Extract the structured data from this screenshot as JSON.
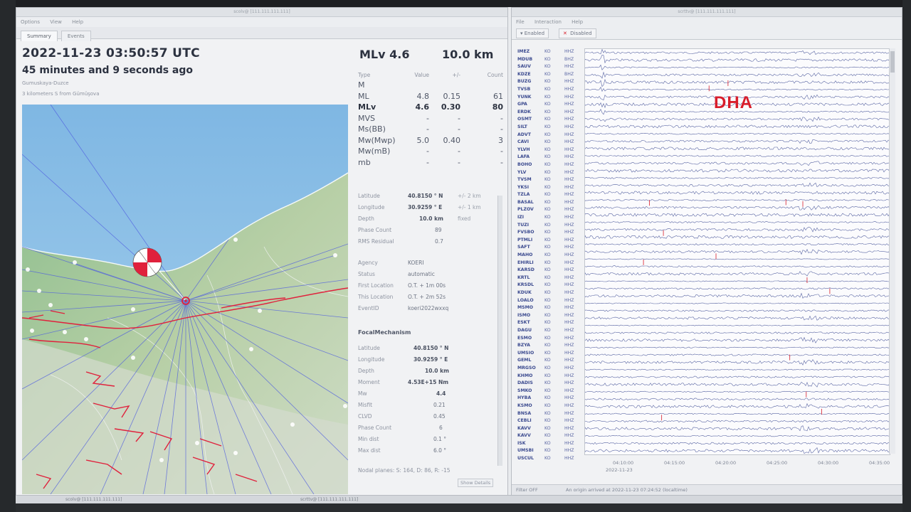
{
  "left_window": {
    "title": "scolv@ [111.111.111.111]",
    "menu": [
      "Options",
      "View",
      "Help"
    ],
    "tabs": [
      "Summary",
      "Events"
    ],
    "event": {
      "time": "2022-11-23 03:50:57 UTC",
      "ago": "45 minutes and 9 seconds ago",
      "region": "Gumuskaya-Duzce",
      "distance": "3 kilometers S from Gümüşova"
    },
    "headline": {
      "magnitude": "MLv 4.6",
      "depth": "10.0 km"
    },
    "magnitudes": {
      "headers": [
        "Type",
        "Value",
        "+/-",
        "Count"
      ],
      "rows": [
        {
          "type": "M",
          "value": "",
          "unc": "",
          "count": ""
        },
        {
          "type": "ML",
          "value": "4.8",
          "unc": "0.15",
          "count": "61"
        },
        {
          "type": "MLv",
          "value": "4.6",
          "unc": "0.30",
          "count": "80"
        },
        {
          "type": "MVS",
          "value": "-",
          "unc": "-",
          "count": "-"
        },
        {
          "type": "Ms(BB)",
          "value": "-",
          "unc": "-",
          "count": "-"
        },
        {
          "type": "Mw(Mwp)",
          "value": "5.0",
          "unc": "0.40",
          "count": "3"
        },
        {
          "type": "Mw(mB)",
          "value": "-",
          "unc": "-",
          "count": "-"
        },
        {
          "type": "mb",
          "value": "-",
          "unc": "-",
          "count": "-"
        }
      ]
    },
    "origin": {
      "latitude": {
        "label": "Latitude",
        "value": "40.8150 ° N",
        "extra": "+/-   2 km"
      },
      "longitude": {
        "label": "Longitude",
        "value": "30.9259 ° E",
        "extra": "+/-   1 km"
      },
      "depth": {
        "label": "Depth",
        "value": "10.0 km",
        "extra": "fixed"
      },
      "phase_count": {
        "label": "Phase Count",
        "value": "89"
      },
      "rms": {
        "label": "RMS Residual",
        "value": "0.7"
      },
      "agency": {
        "label": "Agency",
        "value": "KOERI"
      },
      "status": {
        "label": "Status",
        "value": "automatic"
      },
      "first_location": {
        "label": "First Location",
        "value": "O.T. + 1m 00s"
      },
      "this_location": {
        "label": "This Location",
        "value": "O.T. + 2m 52s"
      },
      "event_id": {
        "label": "EventID",
        "value": "koeri2022wxxq"
      }
    },
    "focal": {
      "title": "FocalMechanism",
      "rows": [
        {
          "label": "Latitude",
          "value": "40.8150 ° N"
        },
        {
          "label": "Longitude",
          "value": "30.9259 ° E"
        },
        {
          "label": "Depth",
          "value": "10.0 km"
        },
        {
          "label": "Moment",
          "value": "4.53E+15 Nm"
        },
        {
          "label": "Mw",
          "value": "4.4"
        },
        {
          "label": "Misfit",
          "value": "0.21"
        },
        {
          "label": "CLVD",
          "value": "0.45"
        },
        {
          "label": "Phase Count",
          "value": "6"
        },
        {
          "label": "Min dist",
          "value": "0.1 °"
        },
        {
          "label": "Max dist",
          "value": "6.0 °"
        }
      ],
      "nodal": "Nodal planes:  S: 164, D: 86, R: -15"
    },
    "show_details": "Show Details"
  },
  "right_window": {
    "title": "scrttv@ [111.111.111.111]",
    "menu": [
      "File",
      "Interaction",
      "Help"
    ],
    "filter_enabled": "Enabled",
    "filter_disabled": "Disabled",
    "stations": [
      [
        "IMEZ",
        "KO",
        "HHZ"
      ],
      [
        "MDUB",
        "KO",
        "BHZ"
      ],
      [
        "SAUV",
        "KO",
        "HHZ"
      ],
      [
        "KDZE",
        "KO",
        "BHZ"
      ],
      [
        "BUZG",
        "KO",
        "HHZ"
      ],
      [
        "TVSB",
        "KO",
        "HHZ"
      ],
      [
        "YUNK",
        "KO",
        "HHZ"
      ],
      [
        "GPA",
        "KO",
        "HHZ"
      ],
      [
        "ERDK",
        "KO",
        "HHZ"
      ],
      [
        "OSMT",
        "KO",
        "HHZ"
      ],
      [
        "SILT",
        "KO",
        "HHZ"
      ],
      [
        "ADVT",
        "KO",
        "HHZ"
      ],
      [
        "CAVI",
        "KO",
        "HHZ"
      ],
      [
        "YLVH",
        "KO",
        "HHZ"
      ],
      [
        "LAFA",
        "KO",
        "HHZ"
      ],
      [
        "BOHO",
        "KO",
        "HHZ"
      ],
      [
        "YLV",
        "KO",
        "HHZ"
      ],
      [
        "TVSM",
        "KO",
        "HHZ"
      ],
      [
        "YKSI",
        "KO",
        "HHZ"
      ],
      [
        "TZLA",
        "KO",
        "HHZ"
      ],
      [
        "BASAL",
        "KO",
        "HHZ"
      ],
      [
        "PLZOV",
        "KO",
        "HHZ"
      ],
      [
        "IZI",
        "KO",
        "HHZ"
      ],
      [
        "TUZI",
        "KO",
        "HHZ"
      ],
      [
        "FVSBO",
        "KO",
        "HHZ"
      ],
      [
        "PTMLI",
        "KO",
        "HHZ"
      ],
      [
        "SAFT",
        "KO",
        "HHZ"
      ],
      [
        "MAHO",
        "KO",
        "HHZ"
      ],
      [
        "EHIRLI",
        "KO",
        "HHZ"
      ],
      [
        "KARSD",
        "KO",
        "HHZ"
      ],
      [
        "KRTL",
        "KO",
        "HHZ"
      ],
      [
        "KRSDL",
        "KO",
        "HHZ"
      ],
      [
        "KDUK",
        "KO",
        "HHZ"
      ],
      [
        "LOALO",
        "KO",
        "HHZ"
      ],
      [
        "MSMO",
        "KO",
        "HHZ"
      ],
      [
        "ISMO",
        "KO",
        "HHZ"
      ],
      [
        "ESKT",
        "KO",
        "HHZ"
      ],
      [
        "DAGU",
        "KO",
        "HHZ"
      ],
      [
        "ESMO",
        "KO",
        "HHZ"
      ],
      [
        "BZYA",
        "KO",
        "HHZ"
      ],
      [
        "UMSIO",
        "KO",
        "HHZ"
      ],
      [
        "GEML",
        "KO",
        "HHZ"
      ],
      [
        "MRGSO",
        "KO",
        "HHZ"
      ],
      [
        "KHMO",
        "KO",
        "HHZ"
      ],
      [
        "DADIS",
        "KO",
        "HHZ"
      ],
      [
        "SMKO",
        "KO",
        "HHZ"
      ],
      [
        "HYBA",
        "KO",
        "HHZ"
      ],
      [
        "KSMO",
        "KO",
        "HHZ"
      ],
      [
        "BNSA",
        "KO",
        "HHZ"
      ],
      [
        "CEBLI",
        "KO",
        "HHZ"
      ],
      [
        "KAVV",
        "KO",
        "HHZ"
      ],
      [
        "KAVV",
        "KO",
        "HHZ"
      ],
      [
        "ISK",
        "KO",
        "HHZ"
      ],
      [
        "UMSBI",
        "KO",
        "HHZ"
      ],
      [
        "USCUL",
        "KO",
        "HHZ"
      ]
    ],
    "time_ticks": [
      "04:10:00",
      "04:15:00",
      "04:20:00",
      "04:25:00",
      "04:30:00",
      "04:35:00"
    ],
    "time_date": "2022-11-23",
    "status_left": "Filter OFF",
    "status_msg": "An origin arrived at 2022-11-23 07:24:52 (localtime)",
    "logo": "DHA"
  },
  "taskbar": {
    "items": [
      "scolv@ [111.111.111.111]",
      "scrttv@ [111.111.111.111]"
    ]
  },
  "colors": {
    "accent": "#d81d2b",
    "trace": "#5b67a4",
    "ray": "#4e5ce0",
    "fault": "#e0213c"
  },
  "icons": [
    "beachball-icon",
    "epicenter-icon",
    "close-icon"
  ]
}
